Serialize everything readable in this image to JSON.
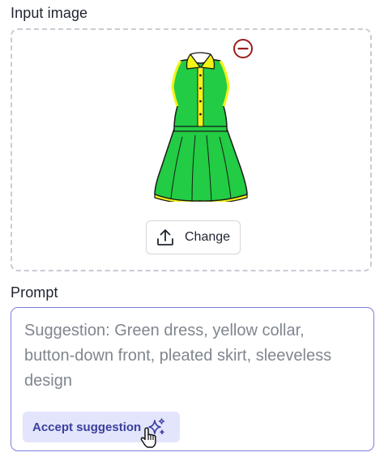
{
  "input_image": {
    "label": "Input image",
    "image_icon": "dress-image",
    "remove_icon": "minus-circle-icon",
    "change_button": {
      "label": "Change",
      "icon": "upload-icon"
    }
  },
  "prompt": {
    "label": "Prompt",
    "placeholder": "Suggestion: Green dress, yellow collar, button-down front, pleated skirt, sleeveless design",
    "accept_button": {
      "label": "Accept suggestion",
      "icon": "sparkle-icon"
    }
  },
  "colors": {
    "accent": "#7b7fdc",
    "accept_bg": "#e2e5fb",
    "accept_text": "#3c3f9e",
    "remove_red": "#9b1c1c",
    "dress_green": "#22cc44",
    "collar_yellow": "#f3f316"
  }
}
